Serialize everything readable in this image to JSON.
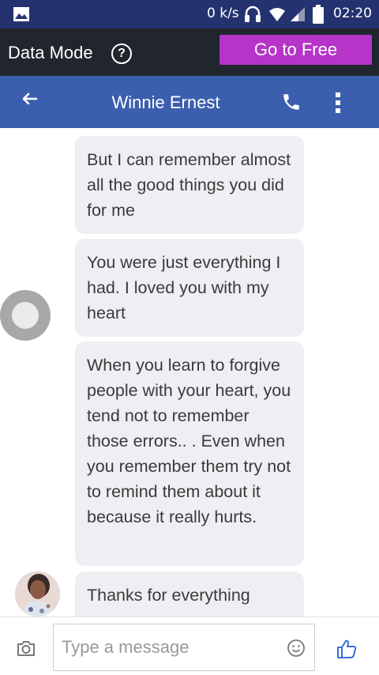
{
  "status_bar": {
    "network_speed": "0 k/s",
    "time": "02:20",
    "icons": [
      "gallery-icon",
      "headphone-icon",
      "wifi-icon",
      "signal-icon",
      "battery-icon"
    ]
  },
  "data_mode_bar": {
    "label": "Data Mode",
    "help_icon": "help-circle-icon",
    "go_free_label": "Go to Free",
    "accent_color": "#b634c8"
  },
  "chat_header": {
    "contact_name": "Winnie Ernest",
    "icons": [
      "back-arrow-icon",
      "phone-icon",
      "more-vertical-icon"
    ],
    "color": "#3b5fae"
  },
  "messages": [
    {
      "text": "But I can remember almost all the good things you did for me"
    },
    {
      "text": "You were just everything I had. I loved you with my heart"
    },
    {
      "text": "When you learn to forgive people with your heart, you tend not to remember those errors.. . Even when you remember them try not to remind them about it because it really hurts."
    },
    {
      "text": "Thanks for everything"
    }
  ],
  "composer": {
    "placeholder": "Type a message",
    "icons": [
      "camera-icon",
      "emoji-icon",
      "thumbs-up-icon"
    ]
  }
}
